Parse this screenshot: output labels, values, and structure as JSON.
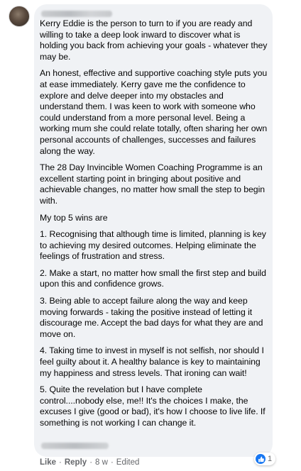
{
  "comment": {
    "author": "",
    "paragraphs": [
      "Kerry Eddie is the person to turn to if you are ready and willing to take a deep look inward to discover what is holding you back from achieving your goals - whatever they may be.",
      "An honest, effective and supportive coaching style puts you at ease immediately. Kerry gave me the confidence to explore and delve deeper into my obstacles and understand them. I was keen to work with someone who could understand from a more personal level. Being a working mum she could relate totally, often sharing her own personal accounts of challenges, successes and failures along the way.",
      "The 28 Day Invincible Women Coaching Programme is an excellent starting point in bringing about positive and achievable changes, no matter how small the step to begin with.",
      "My top 5 wins are",
      "1. Recognising that although time is limited, planning is key to achieving my desired outcomes. Helping eliminate the feelings of frustration and stress.",
      "2. Make a start, no matter how small the first step and build upon this and confidence grows.",
      "3. Being able to accept failure along the way and keep moving forwards - taking the positive instead of letting it discourage me. Accept the bad days for what they are and move on.",
      "4. Taking time to invest in myself is not selfish, nor should I feel guilty about it. A healthy balance is key to maintaining my happiness and stress levels. That ironing can wait!",
      "5. Quite the revelation but I have complete control....nobody else, me!! It's the choices I make, the excuses I give (good or bad), it's how I choose to live life. If something is not working I can change it."
    ],
    "reaction": {
      "icon": "thumbs-up-icon",
      "count": "1"
    },
    "actions": {
      "like": "Like",
      "reply": "Reply",
      "time": "8 w",
      "edited": "Edited",
      "separator": "·"
    }
  },
  "colors": {
    "bubble": "#f0f2f5",
    "text": "#050505",
    "meta": "#65676b",
    "like_blue": "#1877f2"
  }
}
